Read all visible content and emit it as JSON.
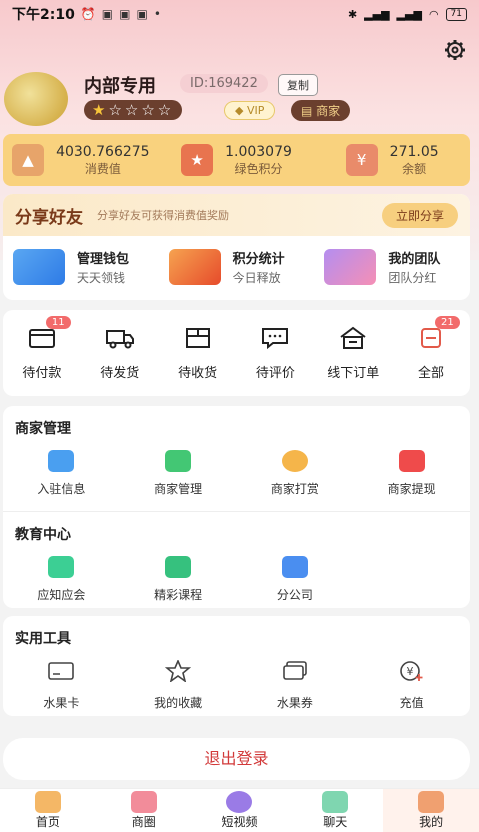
{
  "status": {
    "time": "下午2:10",
    "battery": "71"
  },
  "profile": {
    "name": "内部专用",
    "id": "ID:169422",
    "copy": "复制",
    "stars": "★☆☆☆☆",
    "vip": "VIP",
    "merchant": "商家"
  },
  "stats": [
    {
      "value": "4030.766275",
      "label": "消费值"
    },
    {
      "value": "1.003079",
      "label": "绿色积分"
    },
    {
      "value": "271.05",
      "label": "余额"
    }
  ],
  "share": {
    "title": "分享好友",
    "subtitle": "分享好友可获得消费值奖励",
    "button": "立即分享",
    "items": [
      {
        "title": "管理钱包",
        "sub": "天天领钱"
      },
      {
        "title": "积分统计",
        "sub": "今日释放"
      },
      {
        "title": "我的团队",
        "sub": "团队分红"
      }
    ]
  },
  "orders": [
    {
      "label": "待付款",
      "badge": "11"
    },
    {
      "label": "待发货",
      "badge": ""
    },
    {
      "label": "待收货",
      "badge": ""
    },
    {
      "label": "待评价",
      "badge": ""
    },
    {
      "label": "线下订单",
      "badge": ""
    },
    {
      "label": "全部",
      "badge": "21"
    }
  ],
  "merchant": {
    "title": "商家管理",
    "items": [
      "入驻信息",
      "商家管理",
      "商家打赏",
      "商家提现"
    ]
  },
  "education": {
    "title": "教育中心",
    "items": [
      "应知应会",
      "精彩课程",
      "分公司"
    ]
  },
  "tools": {
    "title": "实用工具",
    "items": [
      "水果卡",
      "我的收藏",
      "水果券",
      "充值"
    ]
  },
  "logout": "退出登录",
  "tabs": [
    "首页",
    "商圈",
    "短视频",
    "聊天",
    "我的"
  ]
}
